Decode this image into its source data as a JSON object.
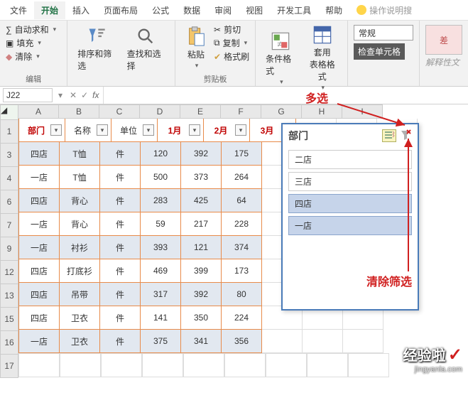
{
  "tabs": {
    "file": "文件",
    "home": "开始",
    "insert": "插入",
    "layout": "页面布局",
    "formula": "公式",
    "data": "数据",
    "review": "审阅",
    "view": "视图",
    "dev": "开发工具",
    "help": "帮助",
    "tellme": "操作说明搜"
  },
  "ribbon": {
    "edit_group": "编辑",
    "autosum": "自动求和",
    "fill": "填充",
    "clear": "清除",
    "sort_filter": "排序和筛选",
    "find_select": "查找和选择",
    "clipboard": "剪贴板",
    "paste": "粘贴",
    "cut": "剪切",
    "copy": "复制",
    "format_painter": "格式刷",
    "cond_fmt": "条件格式",
    "table_fmt": "套用\n表格格式",
    "num_format": "常规",
    "check_cell": "检查单元格",
    "bad": "差",
    "explain": "解释性文"
  },
  "name_box": "J22",
  "fx": "fx",
  "cols": [
    "A",
    "B",
    "C",
    "D",
    "E",
    "F",
    "G",
    "H",
    "I"
  ],
  "row_labels": [
    "1",
    "3",
    "4",
    "6",
    "7",
    "9",
    "12",
    "13",
    "15",
    "16",
    "17"
  ],
  "slicer": {
    "title": "部门",
    "items": [
      "二店",
      "三店",
      "四店",
      "一店"
    ],
    "selected": [
      2,
      3
    ]
  },
  "annotations": {
    "multi": "多选",
    "clear": "清除筛选"
  },
  "watermark": {
    "name": "经验啦",
    "url": "jingyanla.com"
  },
  "chart_data": {
    "type": "table",
    "columns": [
      "部门",
      "名称",
      "单位",
      "1月",
      "2月",
      "3月"
    ],
    "rows": [
      {
        "部门": "四店",
        "名称": "T恤",
        "单位": "件",
        "1月": 120,
        "2月": 392,
        "3月": 175
      },
      {
        "部门": "一店",
        "名称": "T恤",
        "单位": "件",
        "1月": 500,
        "2月": 373,
        "3月": 264
      },
      {
        "部门": "四店",
        "名称": "背心",
        "单位": "件",
        "1月": 283,
        "2月": 425,
        "3月": 64
      },
      {
        "部门": "一店",
        "名称": "背心",
        "单位": "件",
        "1月": 59,
        "2月": 217,
        "3月": 228
      },
      {
        "部门": "一店",
        "名称": "衬衫",
        "单位": "件",
        "1月": 393,
        "2月": 121,
        "3月": 374
      },
      {
        "部门": "四店",
        "名称": "打底衫",
        "单位": "件",
        "1月": 469,
        "2月": 399,
        "3月": 173
      },
      {
        "部门": "四店",
        "名称": "吊带",
        "单位": "件",
        "1月": 317,
        "2月": 392,
        "3月": 80
      },
      {
        "部门": "四店",
        "名称": "卫衣",
        "单位": "件",
        "1月": 141,
        "2月": 350,
        "3月": 224
      },
      {
        "部门": "一店",
        "名称": "卫衣",
        "单位": "件",
        "1月": 375,
        "2月": 341,
        "3月": 356
      }
    ]
  }
}
